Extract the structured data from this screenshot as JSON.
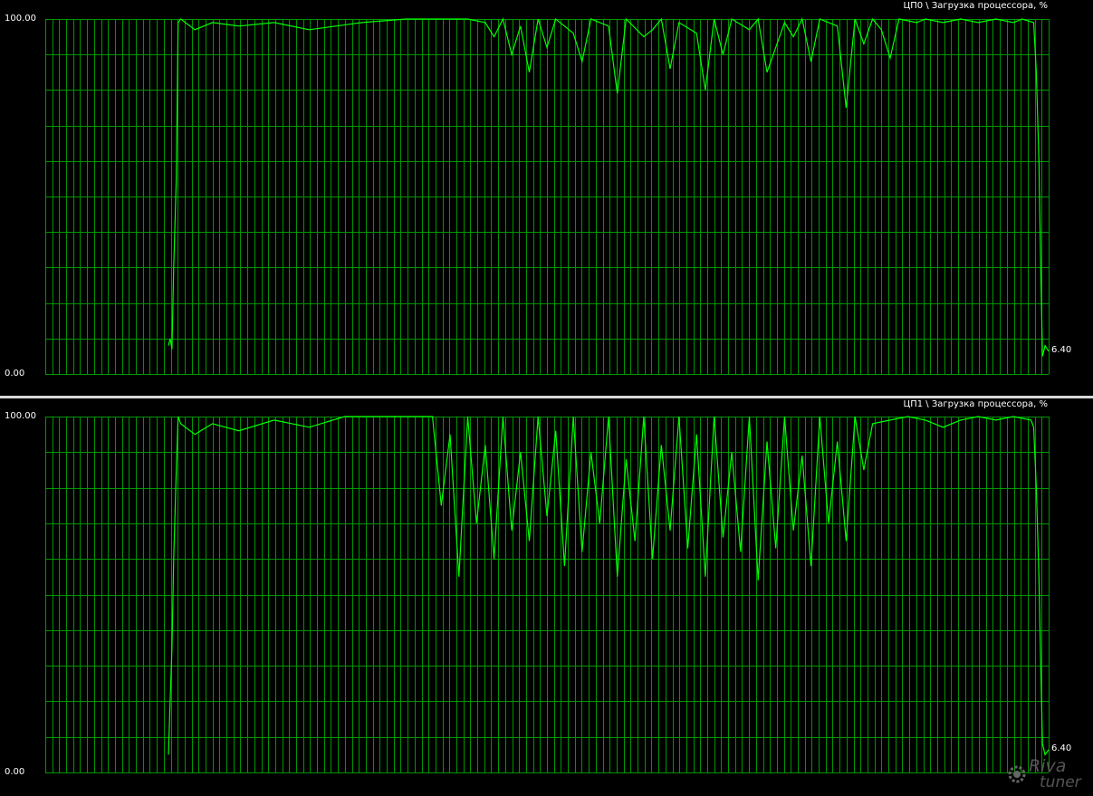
{
  "colors": {
    "background": "#000000",
    "grid": "#009600",
    "line": "#00ff00",
    "separator": "#d8d8d8",
    "text": "#ffffff"
  },
  "logo": {
    "text_top": "Riva",
    "text_bottom": "tuner",
    "icon": "gear-icon"
  },
  "chart_data": [
    {
      "type": "line",
      "title": "ЦП0 \\ Загрузка процессора, %",
      "ylim": [
        0,
        100
      ],
      "ytick_labels": [
        "100.00",
        "0.00"
      ],
      "current_value_label": "6.40",
      "grid": true,
      "x_range": [
        0,
        100
      ],
      "series": [
        {
          "points": [
            [
              0,
              8
            ],
            [
              0.2,
              10
            ],
            [
              0.4,
              7
            ],
            [
              0.6,
              30
            ],
            [
              0.9,
              55
            ],
            [
              1.1,
              99
            ],
            [
              1.4,
              100
            ],
            [
              3,
              97
            ],
            [
              5,
              99
            ],
            [
              8,
              98
            ],
            [
              12,
              99
            ],
            [
              16,
              97
            ],
            [
              22,
              99
            ],
            [
              27,
              100
            ],
            [
              30,
              100
            ],
            [
              34,
              100
            ],
            [
              36,
              99
            ],
            [
              37,
              95
            ],
            [
              38,
              100
            ],
            [
              39,
              90
            ],
            [
              40,
              98
            ],
            [
              41,
              85
            ],
            [
              42,
              100
            ],
            [
              43,
              92
            ],
            [
              44,
              100
            ],
            [
              46,
              96
            ],
            [
              47,
              88
            ],
            [
              48,
              100
            ],
            [
              50,
              98
            ],
            [
              51,
              79
            ],
            [
              52,
              100
            ],
            [
              54,
              95
            ],
            [
              55,
              97
            ],
            [
              56,
              100
            ],
            [
              57,
              86
            ],
            [
              58,
              99
            ],
            [
              60,
              96
            ],
            [
              61,
              80
            ],
            [
              62,
              100
            ],
            [
              63,
              90
            ],
            [
              64,
              100
            ],
            [
              66,
              97
            ],
            [
              67,
              100
            ],
            [
              68,
              85
            ],
            [
              70,
              99
            ],
            [
              71,
              95
            ],
            [
              72,
              100
            ],
            [
              73,
              88
            ],
            [
              74,
              100
            ],
            [
              76,
              98
            ],
            [
              77,
              75
            ],
            [
              78,
              100
            ],
            [
              79,
              93
            ],
            [
              80,
              100
            ],
            [
              81,
              97
            ],
            [
              82,
              89
            ],
            [
              83,
              100
            ],
            [
              85,
              99
            ],
            [
              86,
              100
            ],
            [
              88,
              99
            ],
            [
              90,
              100
            ],
            [
              92,
              99
            ],
            [
              94,
              100
            ],
            [
              96,
              99
            ],
            [
              97,
              100
            ],
            [
              98.3,
              99
            ],
            [
              98.6,
              85
            ],
            [
              98.9,
              60
            ],
            [
              99.1,
              30
            ],
            [
              99.3,
              5
            ],
            [
              99.6,
              8
            ],
            [
              100,
              6.4
            ]
          ]
        }
      ]
    },
    {
      "type": "line",
      "title": "ЦП1 \\ Загрузка процессора, %",
      "ylim": [
        0,
        100
      ],
      "ytick_labels": [
        "100.00",
        "0.00"
      ],
      "current_value_label": "6.40",
      "grid": true,
      "x_range": [
        0,
        100
      ],
      "series": [
        {
          "points": [
            [
              0,
              5
            ],
            [
              0.2,
              20
            ],
            [
              0.4,
              35
            ],
            [
              0.6,
              60
            ],
            [
              0.9,
              85
            ],
            [
              1.1,
              100
            ],
            [
              1.4,
              98
            ],
            [
              3,
              95
            ],
            [
              5,
              98
            ],
            [
              8,
              96
            ],
            [
              12,
              99
            ],
            [
              16,
              97
            ],
            [
              20,
              100
            ],
            [
              24,
              100
            ],
            [
              27,
              100
            ],
            [
              30,
              100
            ],
            [
              31,
              75
            ],
            [
              32,
              95
            ],
            [
              33,
              55
            ],
            [
              34,
              100
            ],
            [
              35,
              70
            ],
            [
              36,
              92
            ],
            [
              37,
              60
            ],
            [
              38,
              100
            ],
            [
              39,
              68
            ],
            [
              40,
              90
            ],
            [
              41,
              65
            ],
            [
              42,
              100
            ],
            [
              43,
              72
            ],
            [
              44,
              96
            ],
            [
              45,
              58
            ],
            [
              46,
              100
            ],
            [
              47,
              62
            ],
            [
              48,
              90
            ],
            [
              49,
              70
            ],
            [
              50,
              100
            ],
            [
              51,
              55
            ],
            [
              52,
              88
            ],
            [
              53,
              65
            ],
            [
              54,
              100
            ],
            [
              55,
              60
            ],
            [
              56,
              92
            ],
            [
              57,
              68
            ],
            [
              58,
              100
            ],
            [
              59,
              63
            ],
            [
              60,
              95
            ],
            [
              61,
              55
            ],
            [
              62,
              100
            ],
            [
              63,
              66
            ],
            [
              64,
              90
            ],
            [
              65,
              62
            ],
            [
              66,
              100
            ],
            [
              67,
              54
            ],
            [
              68,
              93
            ],
            [
              69,
              63
            ],
            [
              70,
              100
            ],
            [
              71,
              68
            ],
            [
              72,
              89
            ],
            [
              73,
              58
            ],
            [
              74,
              100
            ],
            [
              75,
              70
            ],
            [
              76,
              93
            ],
            [
              77,
              65
            ],
            [
              78,
              100
            ],
            [
              79,
              85
            ],
            [
              80,
              98
            ],
            [
              82,
              99
            ],
            [
              84,
              100
            ],
            [
              86,
              99
            ],
            [
              88,
              97
            ],
            [
              90,
              99
            ],
            [
              92,
              100
            ],
            [
              94,
              99
            ],
            [
              96,
              100
            ],
            [
              98,
              99
            ],
            [
              98.3,
              97
            ],
            [
              98.6,
              80
            ],
            [
              98.9,
              55
            ],
            [
              99.1,
              30
            ],
            [
              99.3,
              8
            ],
            [
              99.6,
              5
            ],
            [
              100,
              6.4
            ]
          ]
        }
      ]
    }
  ]
}
